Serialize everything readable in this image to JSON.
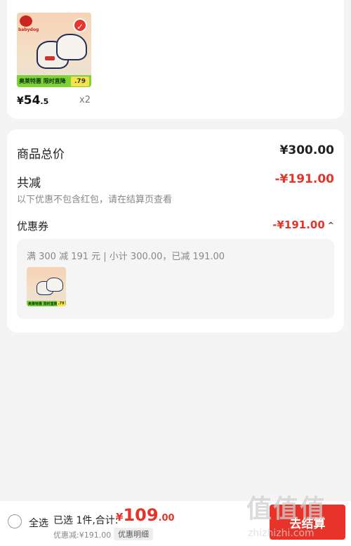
{
  "product": {
    "thumb_strip": "奥莱特惠 限时直降",
    "thumb_price": ".79",
    "price_yen": "¥",
    "price_int": "54",
    "price_dec": ".5",
    "quantity": "x2",
    "brand_logo_text": "babydog"
  },
  "summary": {
    "total_label": "商品总价",
    "total_value": "¥300.00",
    "reduce_label": "共减",
    "reduce_value": "-¥191.00",
    "note": "以下优惠不包含红包，请在结算页查看",
    "coupon_label": "优惠券",
    "coupon_value": "-¥191.00",
    "coupon_detail": "满 300 减 191 元 | 小计 300.00，已减 191.00"
  },
  "bottom_bar": {
    "select_all": "全选",
    "selected_info": "已选 1件,合计:",
    "total_yen": "¥",
    "total_int": "109",
    "total_dec": ".00",
    "discount_line": "优惠减:¥191.00",
    "detail_tag": "优惠明细",
    "checkout": "去结算"
  },
  "watermark": {
    "glyphs": "值值值",
    "url": "zhizhizhi.com"
  },
  "colors": {
    "accent": "#e5342a",
    "background": "#f4f4f4"
  }
}
